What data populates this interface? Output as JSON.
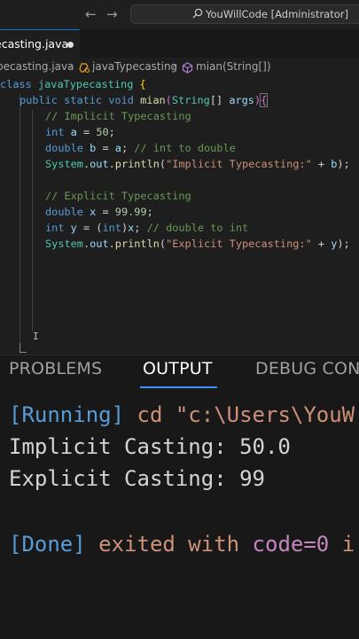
{
  "titlebar": {
    "back_arrow": "←",
    "forward_arrow": "→",
    "search_text": "YouWillCode [Administrator]"
  },
  "tab": {
    "label": "ecasting.java"
  },
  "breadcrumb": {
    "file": "pecasting.java",
    "class_name": "javaTypecasting",
    "method": "mian(String[])"
  },
  "code": {
    "l1_kw": "class",
    "l1_name": "javaTypecasting",
    "l1_brace": "{",
    "l2_mod1": "public",
    "l2_mod2": "static",
    "l2_void": "void",
    "l2_fn": "mian",
    "l2_open": "(",
    "l2_type": "String",
    "l2_arr": "[]",
    "l2_arg": "args",
    "l2_close": ")",
    "l2_brace": "{",
    "l3_comment": "// Implicit Typecasting",
    "l4_type": "int",
    "l4_var": "a",
    "l4_eq": " = ",
    "l4_num": "50",
    "l4_semi": ";",
    "l5_type": "double",
    "l5_var": "b",
    "l5_eq": " = ",
    "l5_val": "a",
    "l5_semi": "; ",
    "l5_comment": "// int to double",
    "l6_sys": "System",
    "l6_dot1": ".",
    "l6_out": "out",
    "l6_dot2": ".",
    "l6_fn": "println",
    "l6_open": "(",
    "l6_str": "\"Implicit Typecasting:\"",
    "l6_plus": " + ",
    "l6_var": "b",
    "l6_end": ");",
    "l8_comment": "// Explicit Typecasting",
    "l9_type": "double",
    "l9_var": "x",
    "l9_eq": " = ",
    "l9_num": "99.99",
    "l9_semi": ";",
    "l10_type": "int",
    "l10_var": "y",
    "l10_eq": " = (",
    "l10_cast": "int",
    "l10_close": ")",
    "l10_val": "x",
    "l10_semi": "; ",
    "l10_comment": "// double to int",
    "l11_sys": "System",
    "l11_dot1": ".",
    "l11_out": "out",
    "l11_dot2": ".",
    "l11_fn": "println",
    "l11_open": "(",
    "l11_str": "\"Explicit Typecasting:\"",
    "l11_plus": " + ",
    "l11_var": "y",
    "l11_end": ");",
    "cursor_glyph": "I"
  },
  "panel": {
    "tabs": [
      "PROBLEMS",
      "OUTPUT",
      "DEBUG CON"
    ],
    "active_tab": "OUTPUT"
  },
  "output": {
    "running": "[Running]",
    "cd_cmd": " cd \"c:\\Users\\YouW",
    "line2": "Implicit Casting: 50.0",
    "line3": "Explicit Casting: 99",
    "done": "[Done]",
    "exited": " exited with ",
    "code_eq": "code=0",
    "tail": " i"
  },
  "colors": {
    "accent": "#3794ff",
    "editor_bg": "#1e1e1e",
    "panel_bg": "#181818"
  }
}
